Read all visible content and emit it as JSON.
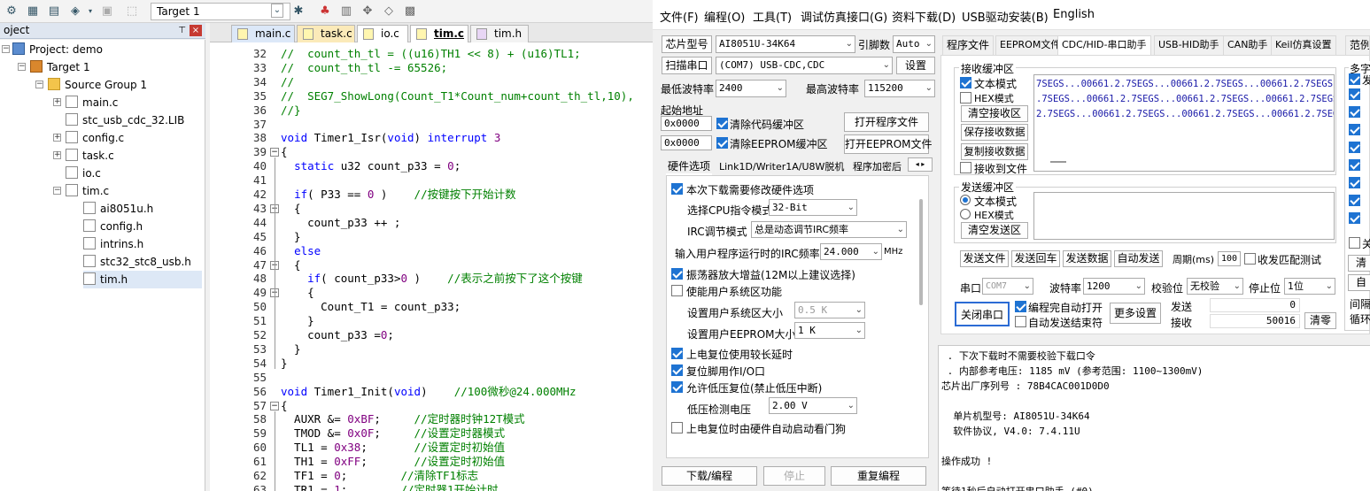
{
  "ide": {
    "target": "Target 1",
    "project_panel_title": "oject",
    "tree": [
      {
        "label": "Project: demo"
      },
      {
        "label": "Target 1"
      },
      {
        "label": "Source Group 1"
      },
      {
        "label": "main.c"
      },
      {
        "label": "stc_usb_cdc_32.LIB"
      },
      {
        "label": "config.c"
      },
      {
        "label": "task.c"
      },
      {
        "label": "io.c"
      },
      {
        "label": "tim.c"
      },
      {
        "label": "ai8051u.h"
      },
      {
        "label": "config.h"
      },
      {
        "label": "intrins.h"
      },
      {
        "label": "stc32_stc8_usb.h"
      },
      {
        "label": "tim.h"
      }
    ],
    "tabs": [
      "main.c",
      "task.c",
      "io.c",
      "tim.c",
      "tim.h"
    ],
    "lines": [
      {
        "n": "32",
        "t": "//  count_th_tl = ((u16)TH1 << 8) + (u16)TL1;"
      },
      {
        "n": "33",
        "t": "//  count_th_tl -= 65526;"
      },
      {
        "n": "34",
        "t": "//"
      },
      {
        "n": "35",
        "t": "//  SEG7_ShowLong(Count_T1*Count_num+count_th_tl,10),"
      },
      {
        "n": "36",
        "t": "//}"
      },
      {
        "n": "37",
        "t": ""
      },
      {
        "n": "38",
        "t": "void Timer1_Isr(void) interrupt 3"
      },
      {
        "n": "39",
        "t": "{"
      },
      {
        "n": "40",
        "t": "  static u32 count_p33 = 0;"
      },
      {
        "n": "41",
        "t": ""
      },
      {
        "n": "42",
        "t": "  if( P33 == 0 )    //按键按下开始计数"
      },
      {
        "n": "43",
        "t": "  {"
      },
      {
        "n": "44",
        "t": "    count_p33 ++ ;"
      },
      {
        "n": "45",
        "t": "  }"
      },
      {
        "n": "46",
        "t": "  else"
      },
      {
        "n": "47",
        "t": "  {"
      },
      {
        "n": "48",
        "t": "    if( count_p33>0 )    //表示之前按下了这个按键"
      },
      {
        "n": "49",
        "t": "    {"
      },
      {
        "n": "50",
        "t": "      Count_T1 = count_p33;"
      },
      {
        "n": "51",
        "t": "    }"
      },
      {
        "n": "52",
        "t": "    count_p33 =0;"
      },
      {
        "n": "53",
        "t": "  }"
      },
      {
        "n": "54",
        "t": "}"
      },
      {
        "n": "55",
        "t": ""
      },
      {
        "n": "56",
        "t": "void Timer1_Init(void)    //100微秒@24.000MHz"
      },
      {
        "n": "57",
        "t": "{"
      },
      {
        "n": "58",
        "t": "  AUXR &= 0xBF;     //定时器时钟12T模式"
      },
      {
        "n": "59",
        "t": "  TMOD &= 0x0F;     //设置定时器模式"
      },
      {
        "n": "60",
        "t": "  TL1 = 0x38;       //设置定时初始值"
      },
      {
        "n": "61",
        "t": "  TH1 = 0xFF;       //设置定时初始值"
      },
      {
        "n": "62",
        "t": "  TF1 = 0;        //清除TF1标志"
      },
      {
        "n": "63",
        "t": "  TR1 = 1;        //定时器1开始计时"
      }
    ]
  },
  "isp": {
    "menu": [
      "文件(F)",
      "编程(O)",
      "工具(T)",
      "调试仿真接口(G)",
      "资料下载(D)",
      "USB驱动安装(B)",
      "English"
    ],
    "chip_label": "芯片型号",
    "chip_value": "AI8051U-34K64",
    "pins_label": "引脚数",
    "pins_value": "Auto",
    "scan_label": "扫描串口",
    "port_value": "(COM7) USB-CDC,CDC",
    "settings_label": "设置",
    "min_baud_label": "最低波特率",
    "min_baud_value": "2400",
    "max_baud_label": "最高波特率",
    "max_baud_value": "115200",
    "start_addr_label": "起始地址",
    "addr1": "0x0000",
    "clear_code_label": "清除代码缓冲区",
    "open_prog_label": "打开程序文件",
    "addr2": "0x0000",
    "clear_eeprom_label": "清除EEPROM缓冲区",
    "open_eeprom_label": "打开EEPROM文件",
    "hw_tabs": [
      "硬件选项",
      "Link1D/Writer1A/U8W脱机",
      "程序加密后"
    ],
    "hw": {
      "opt_modify": "本次下载需要修改硬件选项",
      "cpu_mode_label": "选择CPU指令模式",
      "cpu_mode_value": "32-Bit",
      "irc_adjust_label": "IRC调节模式",
      "irc_adjust_value": "总是动态调节IRC频率",
      "irc_freq_label": "输入用户程序运行时的IRC频率",
      "irc_freq_value": "24.000",
      "irc_unit": "MHz",
      "osc_gain": "振荡器放大增益(12M以上建议选择)",
      "user_sys": "使能用户系统区功能",
      "sys_size_label": "设置用户系统区大小",
      "sys_size_value": "0.5 K",
      "eeprom_size_label": "设置用户EEPROM大小",
      "eeprom_size_value": "1   K",
      "long_reset": "上电复位使用较长延时",
      "reset_io": "复位脚用作I/O口",
      "low_volt_reset": "允许低压复位(禁止低压中断)",
      "low_volt_label": "低压检测电压",
      "low_volt_value": "2.00 V",
      "watchdog": "上电复位时由硬件自动启动看门狗"
    },
    "download_label": "下载/编程",
    "stop_label": "停止",
    "reprogram_label": "重复编程",
    "right_tabs": [
      "程序文件",
      "EEPROM文件",
      "CDC/HID-串口助手",
      "USB-HID助手",
      "CAN助手",
      "Keil仿真设置",
      "范例"
    ],
    "rx_title": "接收缓冲区",
    "rx_text_mode": "文本模式",
    "rx_hex_mode": "HEX模式",
    "rx_clear": "清空接收区",
    "rx_save": "保存接收数据",
    "rx_copy": "复制接收数据",
    "rx_to_file": "接收到文件",
    "rx_lines": [
      "7SEGS...00661.2.7SEGS...00661.2.7SEGS...00661.2.7SEGS...",
      ".7SEGS...00661.2.7SEGS...00661.2.7SEGS...00661.2.7SEGS..",
      "2.7SEGS...00661.2.7SEGS...00661.2.7SEGS...00661.2.7SEGS"
    ],
    "tx_title": "发送缓冲区",
    "tx_text_mode": "文本模式",
    "tx_hex_mode": "HEX模式",
    "tx_clear": "清空发送区",
    "send_file": "发送文件",
    "send_cr": "发送回车",
    "send_data": "发送数据",
    "auto_send": "自动发送",
    "period_label": "周期(ms)",
    "period_value": "100",
    "match_label": "收发匹配测试",
    "port_label": "串口",
    "port_small": "COM7",
    "baud_label": "波特率",
    "baud_value": "1200",
    "parity_label": "校验位",
    "parity_value": "无校验",
    "stop_bits_label": "停止位",
    "stop_bits_value": "1位",
    "close_port": "关闭串口",
    "auto_open": "编程完自动打开",
    "auto_close": "自动发送结束符",
    "more_settings": "更多设置",
    "send_label": "发送",
    "send_count": "0",
    "recv_label": "接收",
    "recv_count": "50016",
    "clear_count": "清零",
    "multi_label": "多字",
    "side_labels": [
      "发",
      "",
      "",
      "",
      "",
      "",
      "",
      "",
      "关",
      "清",
      "自",
      "间隔",
      "循环"
    ],
    "log": [
      " . 下次下载时不需要校验下载口令",
      " . 内部参考电压: 1185 mV (参考范围: 1100~1300mV)",
      "芯片出厂序列号 : 78B4CAC001D0D0",
      "",
      "  单片机型号: AI8051U-34K64",
      "  软件协议, V4.0: 7.4.11U",
      "",
      "操作成功 !",
      "",
      "等待1秒后自动打开串口助手 (#0) ..."
    ]
  }
}
